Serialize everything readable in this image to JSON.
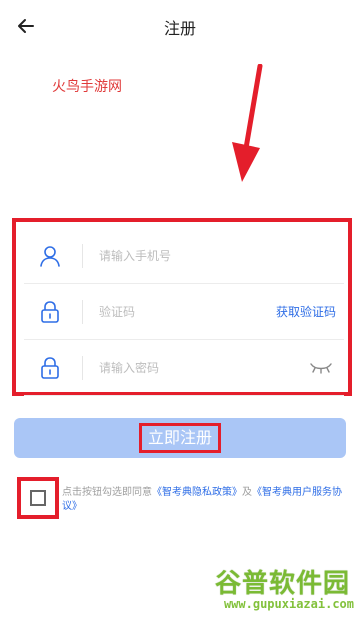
{
  "header": {
    "title": "注册",
    "back_icon": "arrow-left-icon"
  },
  "watermark_top": "火鸟手游网",
  "form": {
    "phone_placeholder": "请输入手机号",
    "code_placeholder": "验证码",
    "get_code_label": "获取验证码",
    "password_placeholder": "请输入密码",
    "icons": {
      "user": "user-icon",
      "lock": "lock-icon",
      "eye": "eye-closed-icon"
    }
  },
  "register_button": {
    "label": "立即注册"
  },
  "agreement": {
    "prefix": "点击按钮勾选即同意",
    "privacy_link": "《智考典隐私政策》",
    "and": "及",
    "user_link": "《智考典用户服务协议》"
  },
  "watermark_bottom": {
    "text": "谷普软件园",
    "url": "www.gupuxiazai.com"
  },
  "colors": {
    "accent": "#2f6ee6",
    "button_bg": "#aac6f6",
    "highlight_red": "#e41e2b"
  }
}
